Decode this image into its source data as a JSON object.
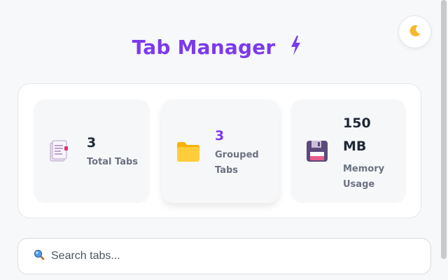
{
  "header": {
    "title": "Tab Manager",
    "title_icon": "lightning-bolt-icon",
    "theme_toggle_icon": "moon-icon"
  },
  "colors": {
    "accent": "#7c3aed",
    "background": "#f7f8fa",
    "card": "#f6f7f9"
  },
  "stats": [
    {
      "icon": "document-icon",
      "value": "3",
      "label": "Total Tabs"
    },
    {
      "icon": "folder-icon",
      "value": "3",
      "label_line1": "Grouped",
      "label_line2": "Tabs"
    },
    {
      "icon": "floppy-disk-icon",
      "value_line1": "150",
      "value_line2": "MB",
      "label_line1": "Memory",
      "label_line2": "Usage"
    }
  ],
  "search": {
    "placeholder": "Search tabs...",
    "icon": "search-icon"
  }
}
